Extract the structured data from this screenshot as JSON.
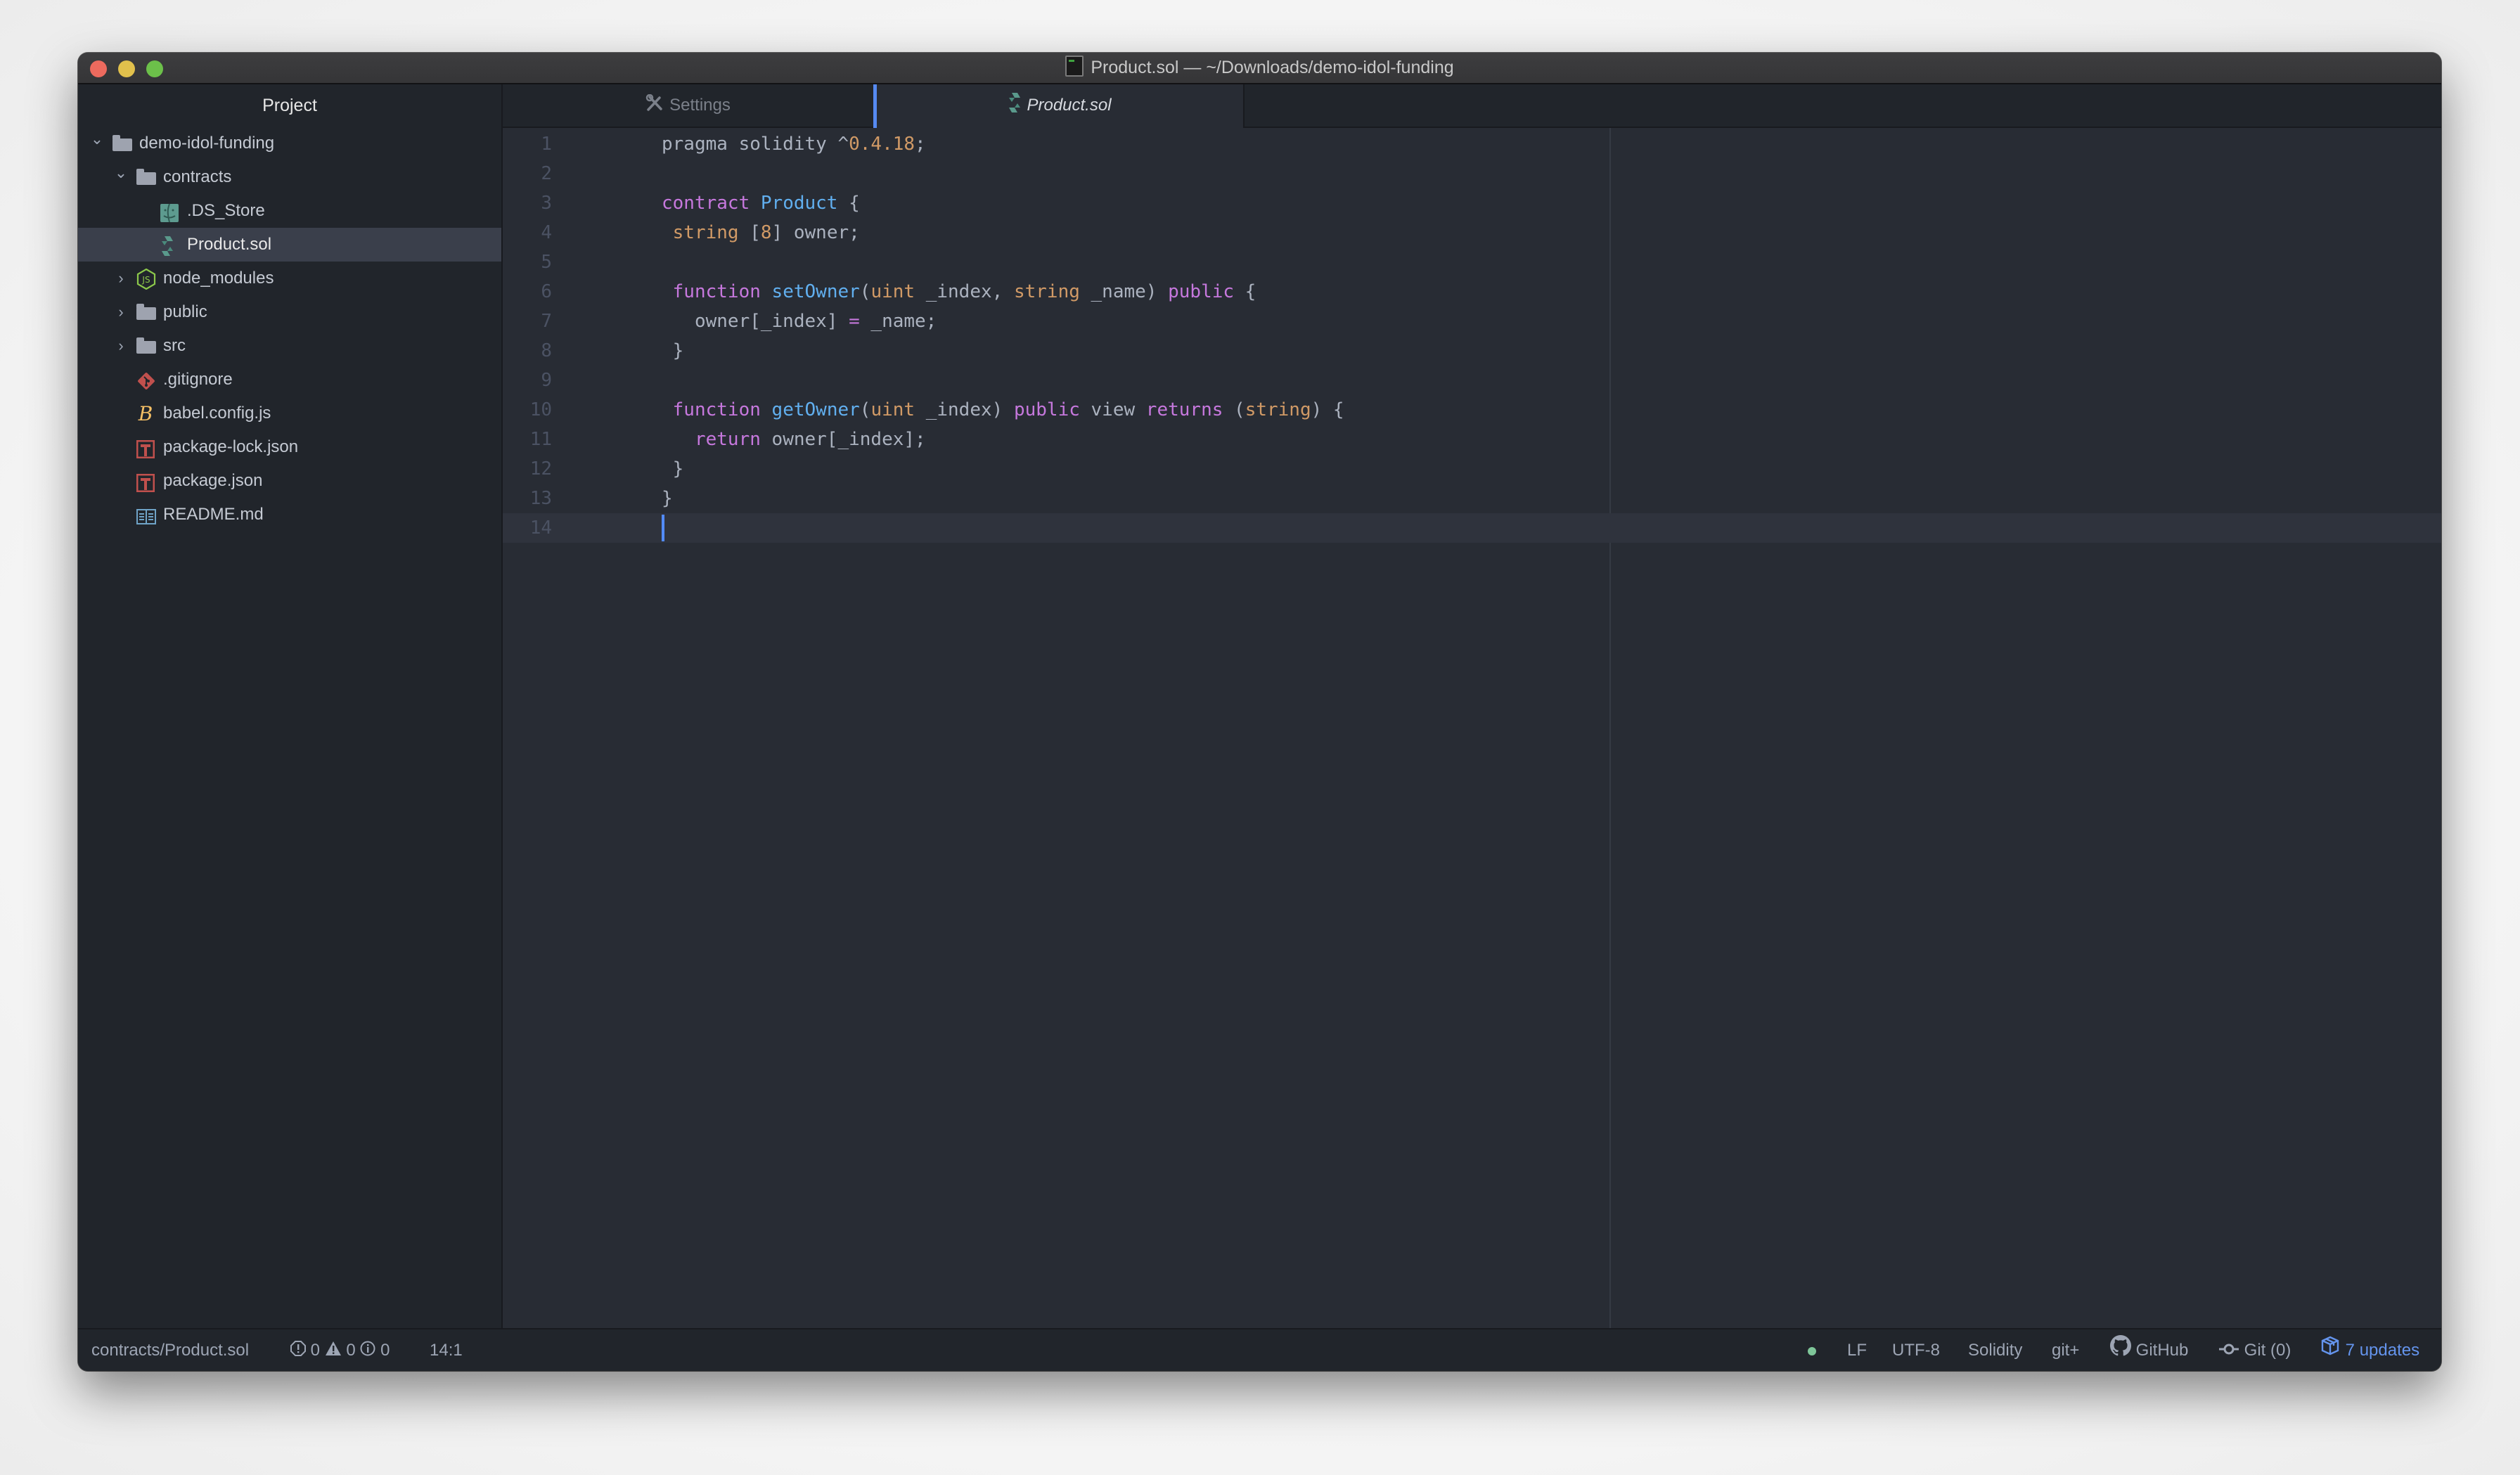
{
  "window": {
    "title": "Product.sol — ~/Downloads/demo-idol-funding"
  },
  "sidebar": {
    "header": "Project",
    "tree": [
      {
        "label": "demo-idol-funding",
        "type": "folder",
        "expanded": true,
        "depth": 0,
        "icon": "folder-icon"
      },
      {
        "label": "contracts",
        "type": "folder",
        "expanded": true,
        "depth": 1,
        "icon": "folder-icon"
      },
      {
        "label": ".DS_Store",
        "type": "file",
        "depth": 2,
        "icon": "finder-icon"
      },
      {
        "label": "Product.sol",
        "type": "file",
        "depth": 2,
        "icon": "solidity-icon",
        "selected": true
      },
      {
        "label": "node_modules",
        "type": "folder",
        "expanded": false,
        "depth": 1,
        "icon": "nodejs-icon"
      },
      {
        "label": "public",
        "type": "folder",
        "expanded": false,
        "depth": 1,
        "icon": "folder-icon"
      },
      {
        "label": "src",
        "type": "folder",
        "expanded": false,
        "depth": 1,
        "icon": "folder-icon"
      },
      {
        "label": ".gitignore",
        "type": "file",
        "depth": 1,
        "icon": "git-icon"
      },
      {
        "label": "babel.config.js",
        "type": "file",
        "depth": 1,
        "icon": "babel-icon"
      },
      {
        "label": "package-lock.json",
        "type": "file",
        "depth": 1,
        "icon": "npm-icon"
      },
      {
        "label": "package.json",
        "type": "file",
        "depth": 1,
        "icon": "npm-icon"
      },
      {
        "label": "README.md",
        "type": "file",
        "depth": 1,
        "icon": "readme-icon"
      }
    ]
  },
  "tabs": [
    {
      "label": "Settings",
      "icon": "tools-icon",
      "active": false
    },
    {
      "label": "Product.sol",
      "icon": "solidity-icon",
      "active": true
    }
  ],
  "editor": {
    "cursor_line": 14,
    "lines": [
      [
        [
          "plain",
          "pragma solidity ^"
        ],
        [
          "num",
          "0.4.18"
        ],
        [
          "plain",
          ";"
        ]
      ],
      [],
      [
        [
          "kw",
          "contract"
        ],
        [
          "plain",
          " "
        ],
        [
          "fn",
          "Product"
        ],
        [
          "plain",
          " {"
        ]
      ],
      [
        [
          "plain",
          " "
        ],
        [
          "type",
          "string"
        ],
        [
          "plain",
          " ["
        ],
        [
          "num",
          "8"
        ],
        [
          "plain",
          "] owner;"
        ]
      ],
      [],
      [
        [
          "plain",
          " "
        ],
        [
          "kw",
          "function"
        ],
        [
          "plain",
          " "
        ],
        [
          "fn",
          "setOwner"
        ],
        [
          "plain",
          "("
        ],
        [
          "type",
          "uint"
        ],
        [
          "plain",
          " _index, "
        ],
        [
          "type",
          "string"
        ],
        [
          "plain",
          " _name) "
        ],
        [
          "kw",
          "public"
        ],
        [
          "plain",
          " {"
        ]
      ],
      [
        [
          "plain",
          "   owner[_index] "
        ],
        [
          "op",
          "="
        ],
        [
          "plain",
          " _name;"
        ]
      ],
      [
        [
          "plain",
          " }"
        ]
      ],
      [],
      [
        [
          "plain",
          " "
        ],
        [
          "kw",
          "function"
        ],
        [
          "plain",
          " "
        ],
        [
          "fn",
          "getOwner"
        ],
        [
          "plain",
          "("
        ],
        [
          "type",
          "uint"
        ],
        [
          "plain",
          " _index) "
        ],
        [
          "kw",
          "public"
        ],
        [
          "plain",
          " view "
        ],
        [
          "kw",
          "returns"
        ],
        [
          "plain",
          " ("
        ],
        [
          "type",
          "string"
        ],
        [
          "plain",
          ") {"
        ]
      ],
      [
        [
          "plain",
          "   "
        ],
        [
          "kw",
          "return"
        ],
        [
          "plain",
          " owner[_index];"
        ]
      ],
      [
        [
          "plain",
          " }"
        ]
      ],
      [
        [
          "plain",
          "}"
        ]
      ],
      []
    ]
  },
  "statusbar": {
    "file_path": "contracts/Product.sol",
    "errors": "0",
    "warnings": "0",
    "infos": "0",
    "cursor_position": "14:1",
    "line_ending": "LF",
    "encoding": "UTF-8",
    "grammar": "Solidity",
    "git_plus": "git+",
    "github": "GitHub",
    "git": "Git (0)",
    "updates": "7 updates",
    "colors": {
      "ok_dot": "#7ec699",
      "updates": "#6494ed"
    }
  }
}
